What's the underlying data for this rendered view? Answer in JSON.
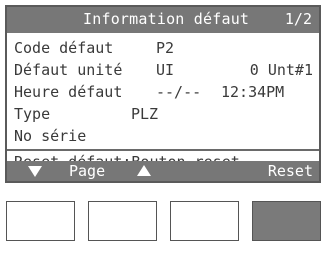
{
  "screen": {
    "title": "Information défaut",
    "page_indicator": "1/2"
  },
  "fields": {
    "error_code_label": "Code défaut",
    "error_code_value": "P2",
    "unit_label": "Défaut unité",
    "unit_value_type": "UI",
    "unit_value_number": "0 Unt#1",
    "time_label": "Heure défaut",
    "time_date": "--/--",
    "time_clock": "12:34PM",
    "type_label": "Type",
    "type_value": "PLZ",
    "serial_label": "No série",
    "serial_value": ""
  },
  "reset_hint": "Reset défaut:Bouton reset",
  "softkeys": {
    "page_label": "Page",
    "reset_label": "Reset"
  },
  "colors": {
    "bar": "#777777",
    "text": "#3a3a3a",
    "active_button": "#7a7a7a"
  }
}
